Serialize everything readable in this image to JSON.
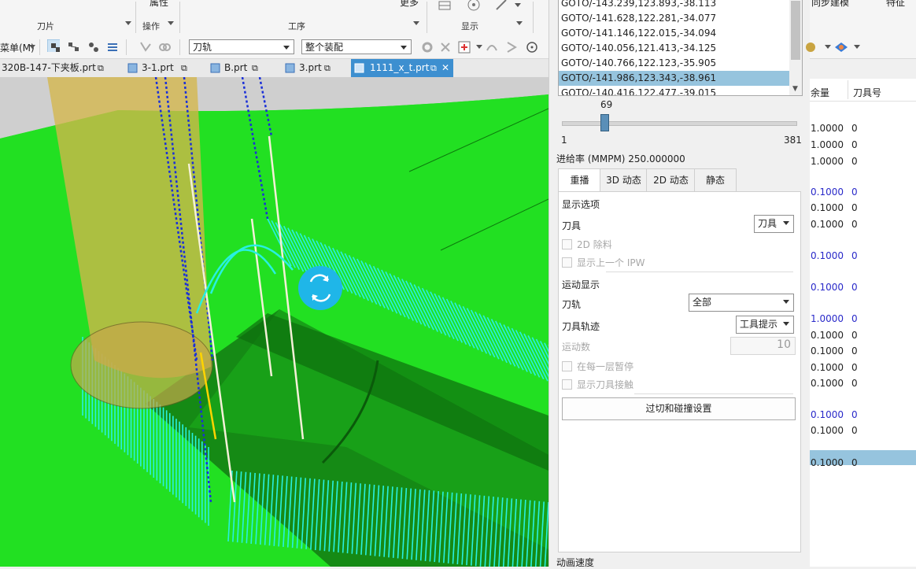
{
  "ribbon": {
    "groups": [
      {
        "label": "刀片"
      },
      {
        "label": "操作"
      },
      {
        "label": "工序"
      },
      {
        "label": "显示"
      }
    ],
    "top_texts": [
      "属性",
      "更多",
      "同步建模",
      "特征"
    ]
  },
  "toolbar": {
    "menu_label": "菜单(M)",
    "combo_toolpath": "刀轨",
    "combo_assembly": "整个装配"
  },
  "file_tabs": [
    {
      "label": "320B-147-下夹板.prt"
    },
    {
      "label": "3-1.prt"
    },
    {
      "label": "B.prt"
    },
    {
      "label": "3.prt"
    },
    {
      "label": "1111_x_t.prt",
      "active": true
    }
  ],
  "panel": {
    "goto_lines": [
      "GOTO/-143.239,123.893,-38.113",
      "GOTO/-141.628,122.281,-34.077",
      "GOTO/-141.146,122.015,-34.094",
      "GOTO/-140.056,121.413,-34.125",
      "GOTO/-140.766,122.123,-35.905",
      "GOTO/-141.986,123.343,-38.961",
      "GOTO/-140.416,122.477,-39.015"
    ],
    "selected_index": 5,
    "slider": {
      "value": "69",
      "min": "1",
      "max": "381",
      "fraction": 0.1789
    },
    "feed_rate": "进给率 (MMPM) 250.000000",
    "tabs": [
      "重播",
      "3D 动态",
      "2D 动态",
      "静态"
    ],
    "display_options": "显示选项",
    "tool_label": "刀具",
    "tool_value": "刀具",
    "cb_2d_removal": "2D 除料",
    "cb_prev_ipw": "显示上一个 IPW",
    "motion_display": "运动显示",
    "toolpath_label": "刀轨",
    "toolpath_value": "全部",
    "tool_trace_label": "刀具轨迹",
    "tool_trace_value": "工具提示",
    "motion_count_label": "运动数",
    "motion_count_value": "10",
    "cb_pause_each_layer": "在每一层暂停",
    "cb_show_tool_contact": "显示刀具接触",
    "gouge_button": "过切和碰撞设置",
    "anim_speed": "动画速度"
  },
  "table": {
    "headers": [
      "余量",
      "刀具号"
    ],
    "rows": [
      {
        "stock": "1.0000",
        "tool": "0",
        "blue": false
      },
      {
        "stock": "1.0000",
        "tool": "0",
        "blue": false
      },
      {
        "stock": "1.0000",
        "tool": "0",
        "blue": false
      },
      {
        "stock": "0.1000",
        "tool": "0",
        "blue": true
      },
      {
        "stock": "0.1000",
        "tool": "0",
        "blue": false
      },
      {
        "stock": "0.1000",
        "tool": "0",
        "blue": false
      },
      {
        "stock": "0.1000",
        "tool": "0",
        "blue": true
      },
      {
        "stock": "0.1000",
        "tool": "0",
        "blue": true
      },
      {
        "stock": "1.0000",
        "tool": "0",
        "blue": true
      },
      {
        "stock": "0.1000",
        "tool": "0",
        "blue": false
      },
      {
        "stock": "0.1000",
        "tool": "0",
        "blue": false
      },
      {
        "stock": "0.1000",
        "tool": "0",
        "blue": false
      },
      {
        "stock": "0.1000",
        "tool": "0",
        "blue": false
      },
      {
        "stock": "0.1000",
        "tool": "0",
        "blue": true
      },
      {
        "stock": "0.1000",
        "tool": "0",
        "blue": false
      },
      {
        "stock": "0.1000",
        "tool": "0",
        "blue": false
      }
    ]
  },
  "colors": {
    "part_green": "#22e022",
    "toolpath_cyan": "#28f0e0",
    "selection_blue": "#96c4de",
    "active_tab_blue": "#3d8fd0"
  }
}
